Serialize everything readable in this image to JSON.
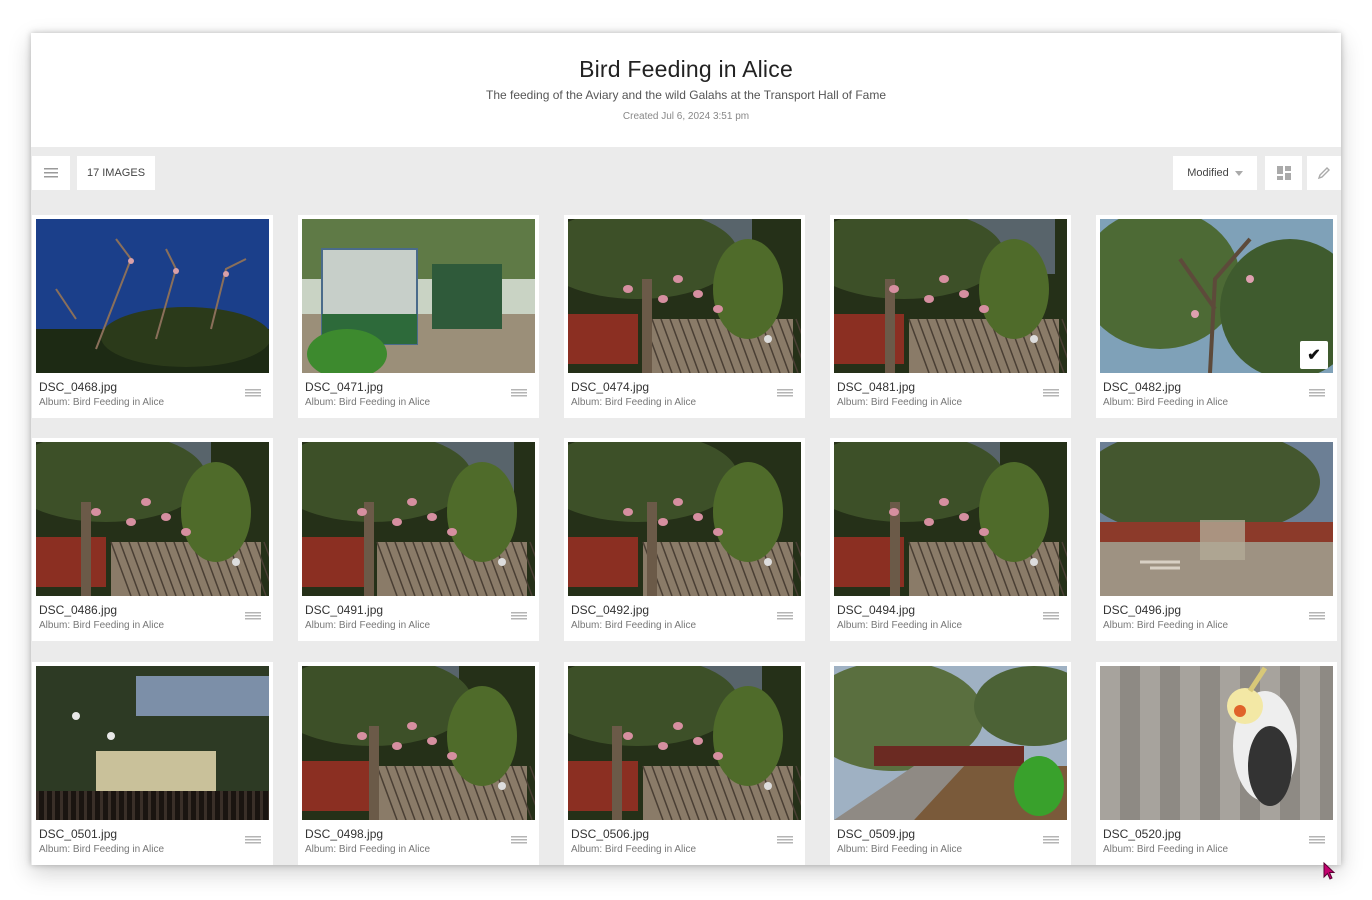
{
  "header": {
    "title": "Bird Feeding in Alice",
    "description": "The feeding of the Aviary and the wild Galahs at the Transport Hall of Fame",
    "created": "Created Jul 6, 2024 3:51 pm"
  },
  "toolbar": {
    "menu_icon": "hamburger-icon",
    "image_count": "17 IMAGES",
    "sort_label": "Modified",
    "layout_icon": "grid-layout-icon",
    "edit_icon": "pencil-icon"
  },
  "images": [
    {
      "file": "DSC_0468.jpg",
      "album": "Album: Bird Feeding in Alice",
      "selected": false,
      "scene": "sky"
    },
    {
      "file": "DSC_0471.jpg",
      "album": "Album: Bird Feeding in Alice",
      "selected": false,
      "scene": "aviary"
    },
    {
      "file": "DSC_0474.jpg",
      "album": "Album: Bird Feeding in Alice",
      "selected": false,
      "scene": "garden"
    },
    {
      "file": "DSC_0481.jpg",
      "album": "Album: Bird Feeding in Alice",
      "selected": false,
      "scene": "garden"
    },
    {
      "file": "DSC_0482.jpg",
      "album": "Album: Bird Feeding in Alice",
      "selected": true,
      "scene": "tree"
    },
    {
      "file": "DSC_0486.jpg",
      "album": "Album: Bird Feeding in Alice",
      "selected": false,
      "scene": "fence"
    },
    {
      "file": "DSC_0491.jpg",
      "album": "Album: Bird Feeding in Alice",
      "selected": false,
      "scene": "fence"
    },
    {
      "file": "DSC_0492.jpg",
      "album": "Album: Bird Feeding in Alice",
      "selected": false,
      "scene": "fence"
    },
    {
      "file": "DSC_0494.jpg",
      "album": "Album: Bird Feeding in Alice",
      "selected": false,
      "scene": "fence"
    },
    {
      "file": "DSC_0496.jpg",
      "album": "Album: Bird Feeding in Alice",
      "selected": false,
      "scene": "yard"
    },
    {
      "file": "DSC_0501.jpg",
      "album": "Album: Bird Feeding in Alice",
      "selected": false,
      "scene": "lattice"
    },
    {
      "file": "DSC_0498.jpg",
      "album": "Album: Bird Feeding in Alice",
      "selected": false,
      "scene": "fence"
    },
    {
      "file": "DSC_0506.jpg",
      "album": "Album: Bird Feeding in Alice",
      "selected": false,
      "scene": "fence"
    },
    {
      "file": "DSC_0509.jpg",
      "album": "Album: Bird Feeding in Alice",
      "selected": false,
      "scene": "path"
    },
    {
      "file": "DSC_0520.jpg",
      "album": "Album: Bird Feeding in Alice",
      "selected": false,
      "scene": "cockatiel"
    }
  ],
  "colors": {
    "background": "#ebebeb",
    "card": "#ffffff",
    "accent_cursor": "#c4006e"
  }
}
